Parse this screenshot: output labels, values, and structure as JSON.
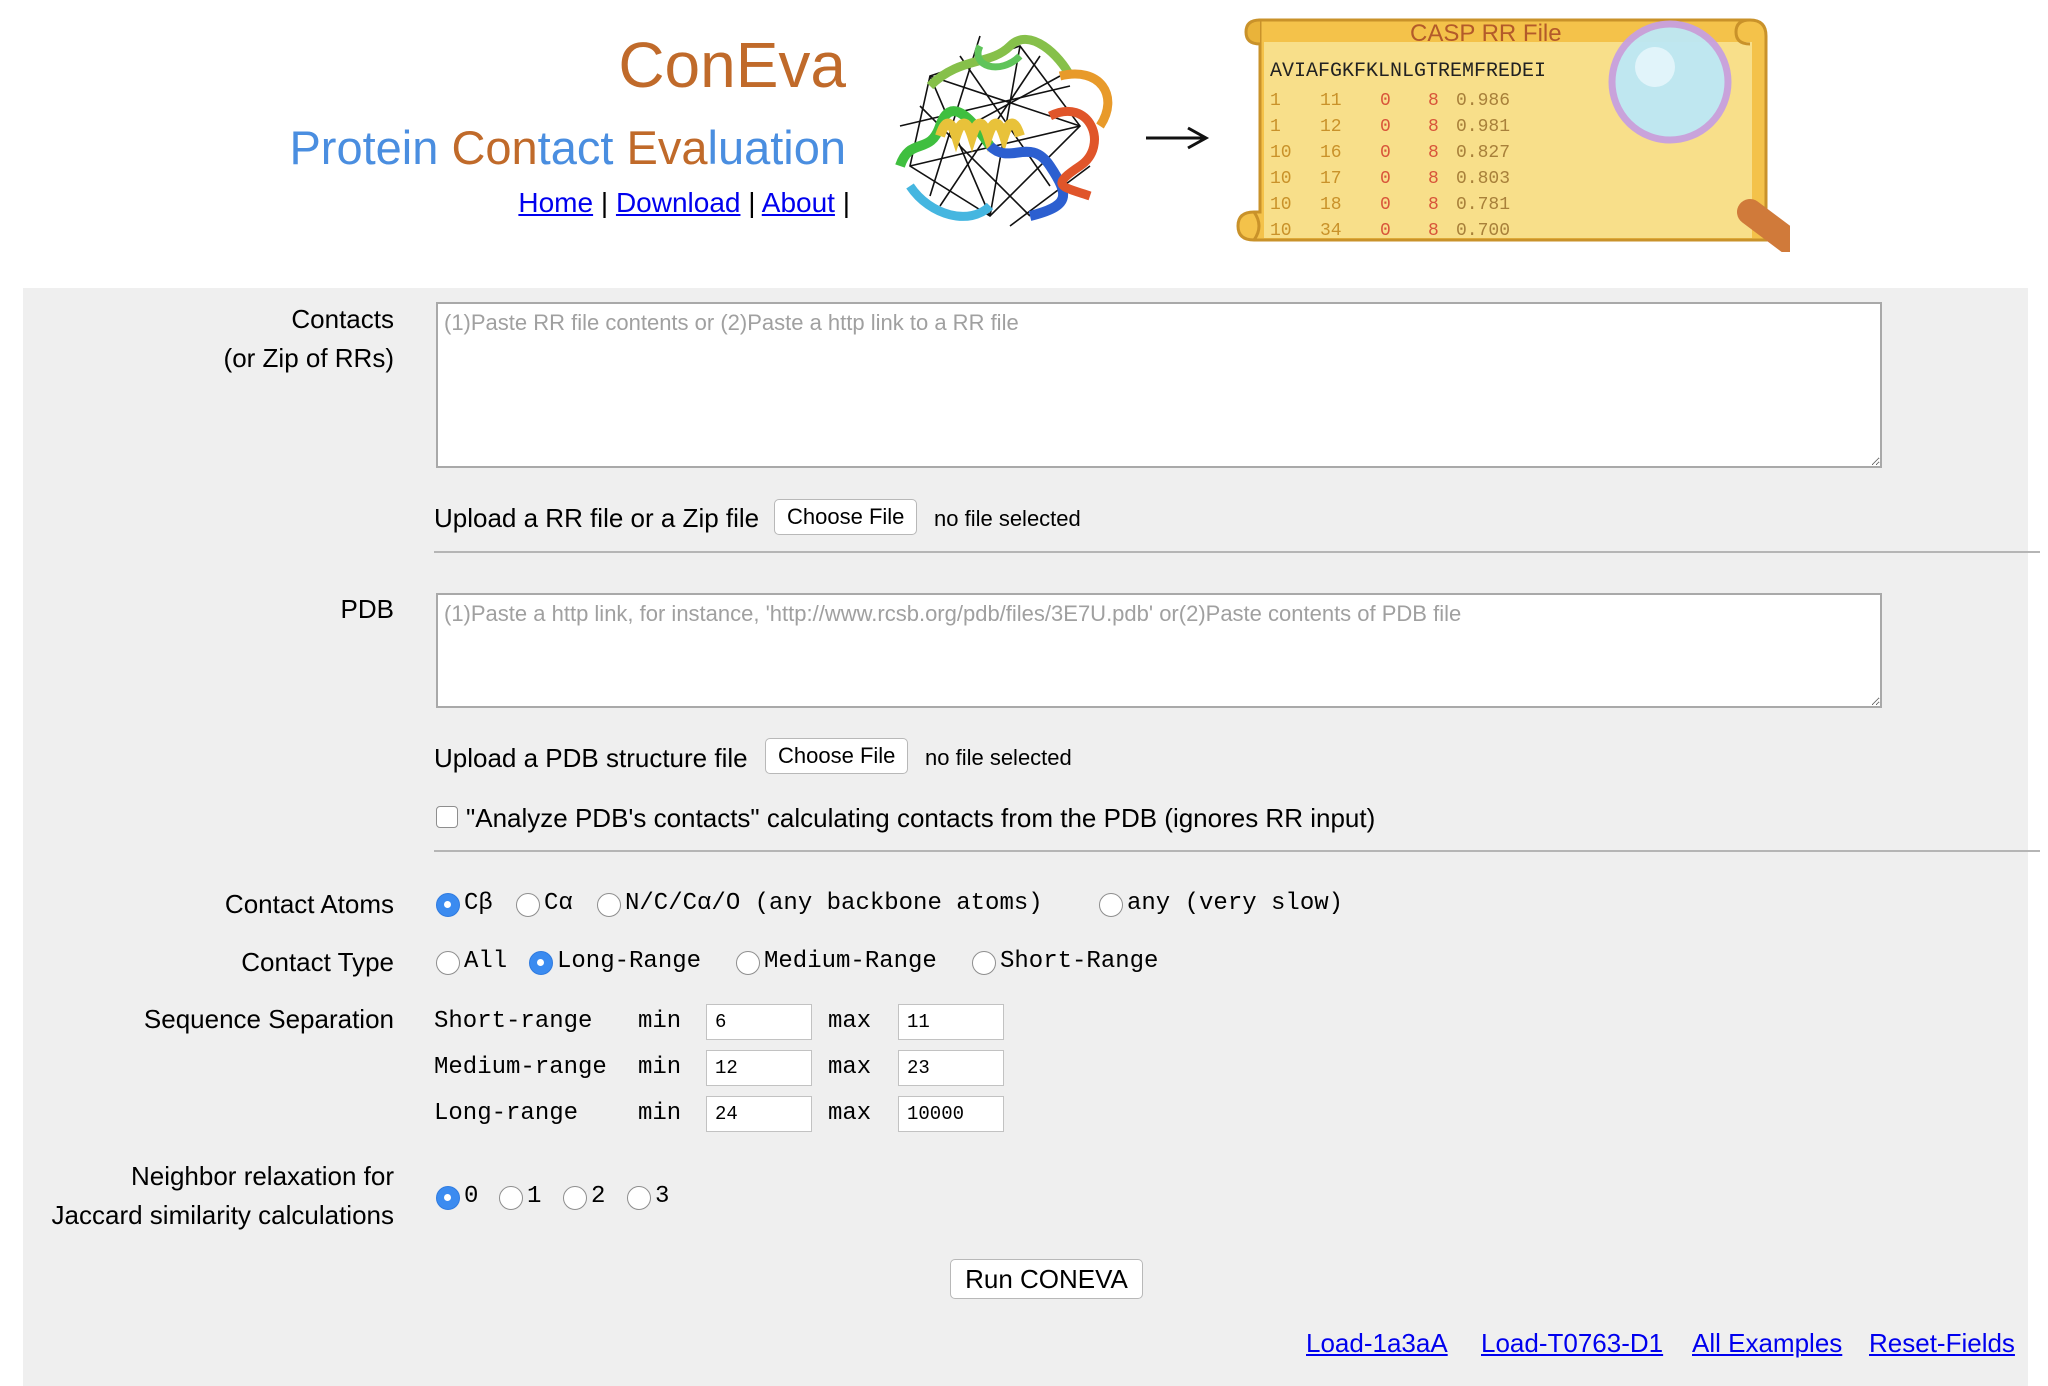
{
  "header": {
    "title": "ConEva",
    "subtitle_parts": [
      "Protein ",
      "Con",
      "tact ",
      "Eva",
      "luation"
    ],
    "nav": [
      "Home",
      "Download",
      "About"
    ],
    "nav_separator": " | "
  },
  "scroll_illustration": {
    "title": "CASP RR File",
    "sequence": "AVIAFGKFKLNLGTREMFREDEI",
    "rows": [
      [
        "1",
        "11",
        "0",
        "8",
        "0.986"
      ],
      [
        "1",
        "12",
        "0",
        "8",
        "0.981"
      ],
      [
        "10",
        "16",
        "0",
        "8",
        "0.827"
      ],
      [
        "10",
        "17",
        "0",
        "8",
        "0.803"
      ],
      [
        "10",
        "18",
        "0",
        "8",
        "0.781"
      ],
      [
        "10",
        "34",
        "0",
        "8",
        "0.700"
      ]
    ]
  },
  "contacts": {
    "label_line1": "Contacts",
    "label_line2": "(or Zip of RRs)",
    "placeholder": "(1)Paste RR file contents or (2)Paste a http link to a RR file",
    "upload_label": "Upload a RR file or a Zip file",
    "choose_file": "Choose File",
    "file_status": "no file selected"
  },
  "pdb": {
    "label": "PDB",
    "placeholder": "(1)Paste a http link, for instance, 'http://www.rcsb.org/pdb/files/3E7U.pdb' or(2)Paste contents of PDB file",
    "upload_label": "Upload a PDB structure file",
    "choose_file": "Choose File",
    "file_status": "no file selected",
    "analyze_checkbox_label": "\"Analyze PDB's contacts\" calculating contacts from the PDB (ignores RR input)",
    "analyze_checked": false
  },
  "contact_atoms": {
    "label": "Contact Atoms",
    "options": [
      "Cβ",
      "Cα",
      "N/C/Cα/O (any backbone atoms)",
      "any (very slow)"
    ],
    "selected": "Cβ"
  },
  "contact_type": {
    "label": "Contact Type",
    "options": [
      "All",
      "Long-Range",
      "Medium-Range",
      "Short-Range"
    ],
    "selected": "Long-Range"
  },
  "sequence_separation": {
    "label": "Sequence Separation",
    "min_label": "min",
    "max_label": "max",
    "rows": [
      {
        "name": "Short-range",
        "min": "6",
        "max": "11"
      },
      {
        "name": "Medium-range",
        "min": "12",
        "max": "23"
      },
      {
        "name": "Long-range",
        "min": "24",
        "max": "10000"
      }
    ]
  },
  "neighbor_relaxation": {
    "label_line1": "Neighbor relaxation for",
    "label_line2": "Jaccard similarity calculations",
    "options": [
      "0",
      "1",
      "2",
      "3"
    ],
    "selected": "0"
  },
  "run_button": "Run CONEVA",
  "footer_links": [
    "Load-1a3aA",
    "Load-T0763-D1",
    "All Examples",
    "Reset-Fields"
  ],
  "colors": {
    "title_orange": "#c06a2a",
    "subtitle_blue": "#4a8ee0",
    "link_blue": "#0000ee",
    "panel_gray": "#efefef",
    "radio_selected": "#3b8bf0"
  }
}
